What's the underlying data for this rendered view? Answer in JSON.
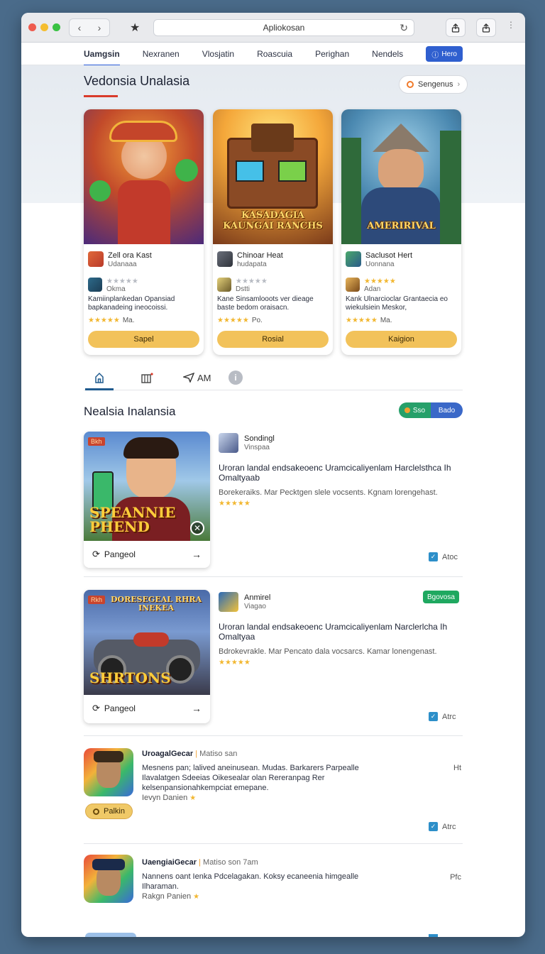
{
  "browser": {
    "address": "Apliokosan",
    "lights": [
      "#ee5b4e",
      "#f5bd2f",
      "#39c243"
    ]
  },
  "topnav": {
    "links": [
      "Uamgsin",
      "Nexranen",
      "Vlosjatin",
      "Roascuia",
      "Perighan",
      "Nendels"
    ],
    "active_index": 0,
    "menu_button": "Hero"
  },
  "featured": {
    "title": "Vedonsia Unalasia",
    "more_button": "Sengenus",
    "cards": [
      {
        "name": "Zell ora Kast",
        "sub": "Udanaaa",
        "reviewer": "Okma",
        "desc": "Kamiinplankedan Opansiad bapkanadeing ineocoissi.",
        "rating_text": "Ma.",
        "button": "Sapel"
      },
      {
        "name": "Chinoar Heat",
        "sub": "hudapata",
        "reviewer": "Dstti",
        "desc": "Kane Sinsamlooots ver dieage baste bedom oraisacn.",
        "rating_text": "Po.",
        "art_title": "KASADAGIA KAUNGAI RANCHS",
        "button": "Rosial"
      },
      {
        "name": "Saclusot Hert",
        "sub": "Uonnana",
        "reviewer": "Adan",
        "desc": "Kank Ulnarcioclar Grantaecia eo wiekulsiein Meskor,",
        "rating_text": "Ma.",
        "art_title": "AMERIRIVAL",
        "button": "Kaigion"
      }
    ]
  },
  "tabs": {
    "items": [
      "",
      "",
      "AM",
      ""
    ],
    "active_index": 0
  },
  "list": {
    "title": "Nealsia Inalansia",
    "toggle": [
      "Sso",
      "Bado"
    ],
    "items": [
      {
        "tag": "Bkh",
        "art_title": "SPEANNIE PHEND",
        "foot_label": "Pangeol",
        "name": "Sondingl",
        "sub": "Vinspaa",
        "title": "Uroran landal endsakeoenc Uramcicaliyenlam Harclelsthca Ih Omaltyaab",
        "desc": "Borekeraiks. Mar Pecktgen slele vocsents. Kgnam lorengehast.",
        "check": "Atoc"
      },
      {
        "tag": "Rkh",
        "art_title_top": "DORESEGEAL RHRA INEKEA",
        "art_title": "SHRTONS",
        "foot_label": "Pangeol",
        "name": "Anmirel",
        "sub": "Viagao",
        "badge": "Bgovosa",
        "title": "Uroran landal endsakeoenc Uramcicaliyenlam Narclerlcha Ih Omaltyaa",
        "desc": "Bdrokevrakle. Mar Pencato dala vocsarcs. Kamar lonengenast.",
        "check": "Atrc"
      }
    ],
    "small_items": [
      {
        "name": "UroagalGecar",
        "meta": "Matiso san",
        "desc": "Mesnens pan; lalived aneinusean. Mudas. Barkarers Parpealle Ilavalatgen Sdeeias Oikesealar olan Rereranpag Rer kelsenpansionahkempciat emepane.",
        "sub": "Ievyn Danien",
        "right": "Ht",
        "pill": "Palkin",
        "check": "Atrc"
      },
      {
        "name": "UaengiaiGecar",
        "meta": "Matiso son 7am",
        "desc": "Nannens oant Ienka Pdcelagakan. Koksy ecaneenia himgealle Ilharaman.",
        "sub": "Rakgn Panien",
        "right": "Pfc"
      }
    ]
  }
}
